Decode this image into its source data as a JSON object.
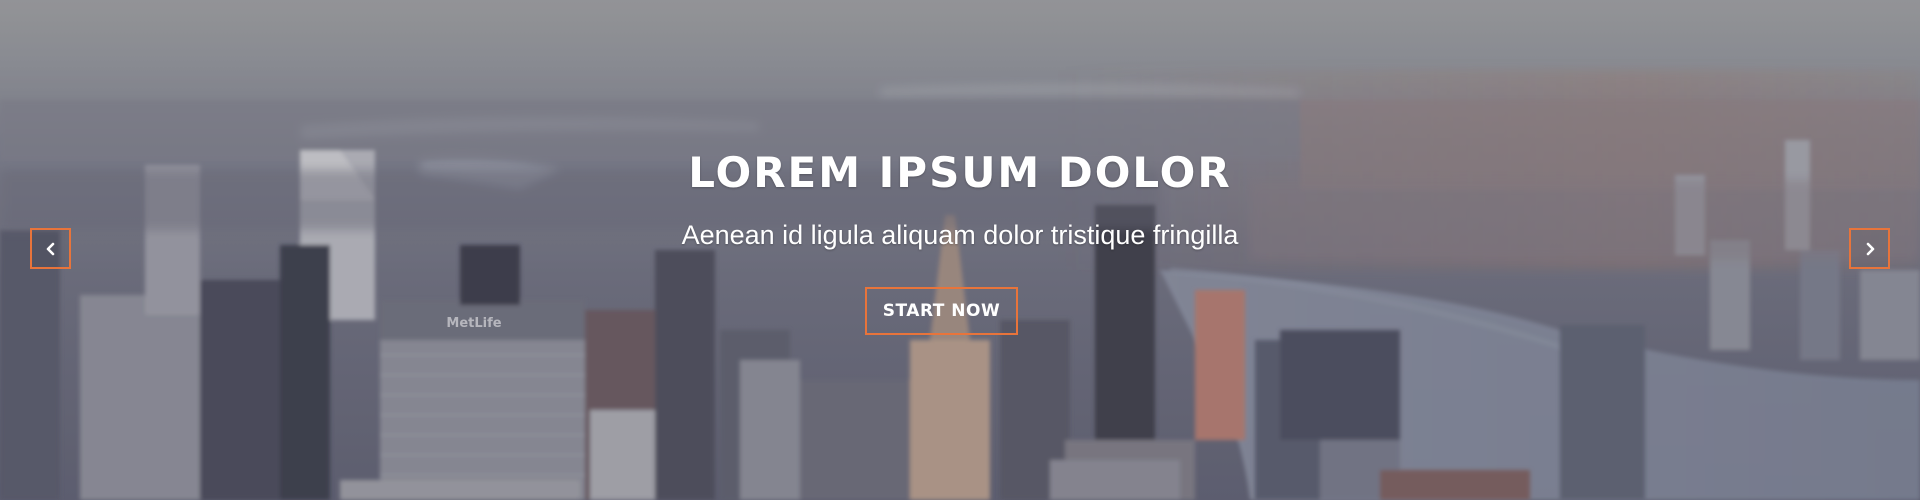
{
  "hero": {
    "title": "LOREM IPSUM DOLOR",
    "subtitle": "Aenean id ligula aliquam dolor tristique fringilla",
    "cta_label": "START NOW",
    "background": "city-skyline-image",
    "accent_color": "#e8743b"
  },
  "slider": {
    "prev_icon": "chevron-left-icon",
    "next_icon": "chevron-right-icon"
  }
}
